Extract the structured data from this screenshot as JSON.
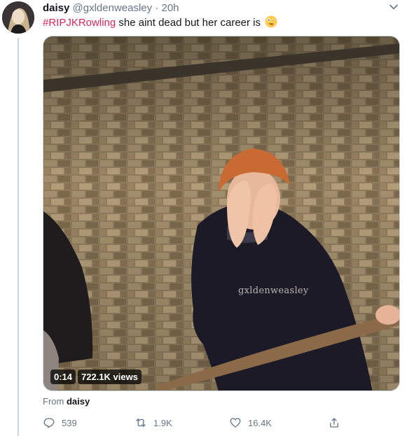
{
  "tweet": {
    "author_name": "daisy",
    "author_handle": "@gxldenweasley",
    "separator": "·",
    "time": "20h",
    "hashtag": "#RIPJKRowling",
    "text": " she aint dead but her career is",
    "emoji": "zany-face-emoji"
  },
  "media": {
    "watermark": "gxldenweasley",
    "duration": "0:14",
    "views": "722.1K views"
  },
  "source": {
    "prefix": "From",
    "name": "daisy"
  },
  "actions": {
    "reply_count": "539",
    "retweet_count": "1.9K",
    "like_count": "16.4K"
  },
  "colors": {
    "hashtag": "#e0245e",
    "secondary_text": "#657786",
    "divider": "#ccd6dd"
  },
  "icons": [
    "caret-down-icon",
    "reply-icon",
    "retweet-icon",
    "like-icon",
    "share-icon"
  ]
}
